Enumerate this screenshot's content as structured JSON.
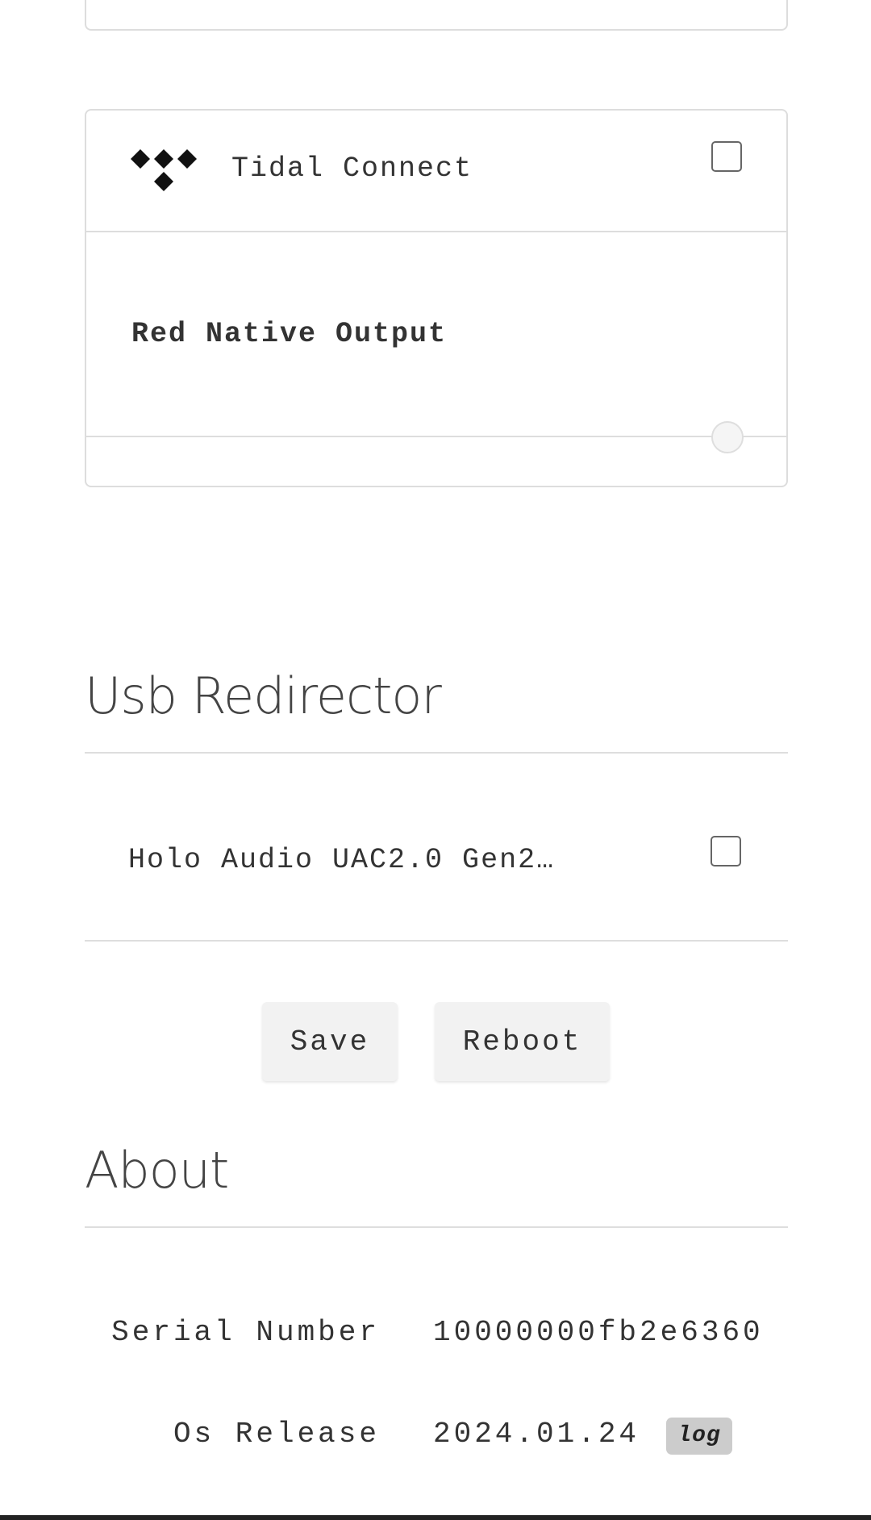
{
  "outputs": {
    "tidal": {
      "label": "Tidal Connect",
      "icon": "tidal-logo-icon",
      "checked": false
    },
    "red_native": {
      "label": "Red Native Output",
      "selected": false
    }
  },
  "usb_redirector": {
    "title": "Usb Redirector",
    "device": {
      "label": "Holo Audio UAC2.0 Gen2…",
      "checked": false
    }
  },
  "actions": {
    "save_label": "Save",
    "reboot_label": "Reboot"
  },
  "about": {
    "title": "About",
    "serial_label": "Serial Number",
    "serial_value": "10000000fb2e6360",
    "os_label": "Os Release",
    "os_value": "2024.01.24",
    "log_label": "log"
  },
  "colors": {
    "border": "#dddddd",
    "button_bg": "#f2f2f2",
    "badge_bg": "#cccccc",
    "text": "#333333"
  }
}
